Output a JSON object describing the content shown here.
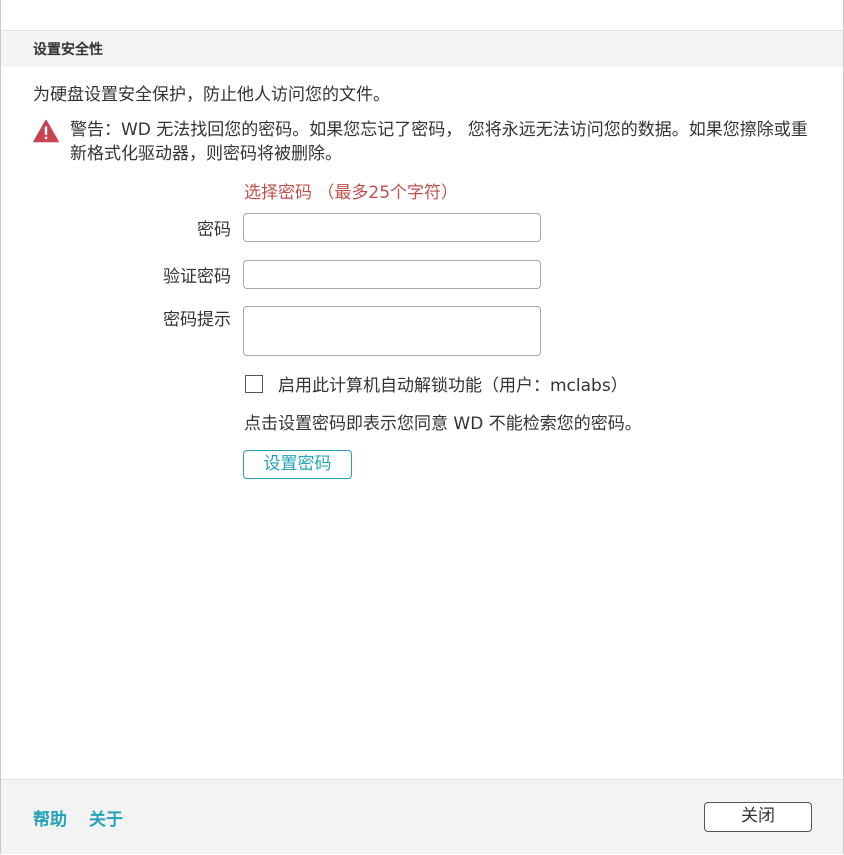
{
  "section": {
    "title": "设置安全性"
  },
  "intro_text": "为硬盘设置安全保护，防止他人访问您的文件。",
  "warning": {
    "icon": "warning-triangle-icon",
    "icon_color": "#c9424f",
    "text": "警告：WD 无法找回您的密码。如果您忘记了密码， 您将永远无法访问您的数据。如果您擦除或重新格式化驱动器，则密码将被删除。"
  },
  "form": {
    "choose_label": "选择密码 （最多25个字符）",
    "choose_label_color": "#c0504d",
    "password_label": "密码",
    "password_value": "",
    "verify_label": "验证密码",
    "verify_value": "",
    "hint_label": "密码提示",
    "hint_value": "",
    "auto_unlock_label": "启用此计算机自动解锁功能（用户：mclabs）",
    "auto_unlock_checked": false,
    "consent_text": "点击设置密码即表示您同意 WD 不能检索您的密码。",
    "set_password_button": "设置密码"
  },
  "footer": {
    "help_link": "帮助",
    "about_link": "关于",
    "close_button": "关闭"
  },
  "colors": {
    "accent": "#24a3b8",
    "header_bg": "#f3f3f3"
  }
}
